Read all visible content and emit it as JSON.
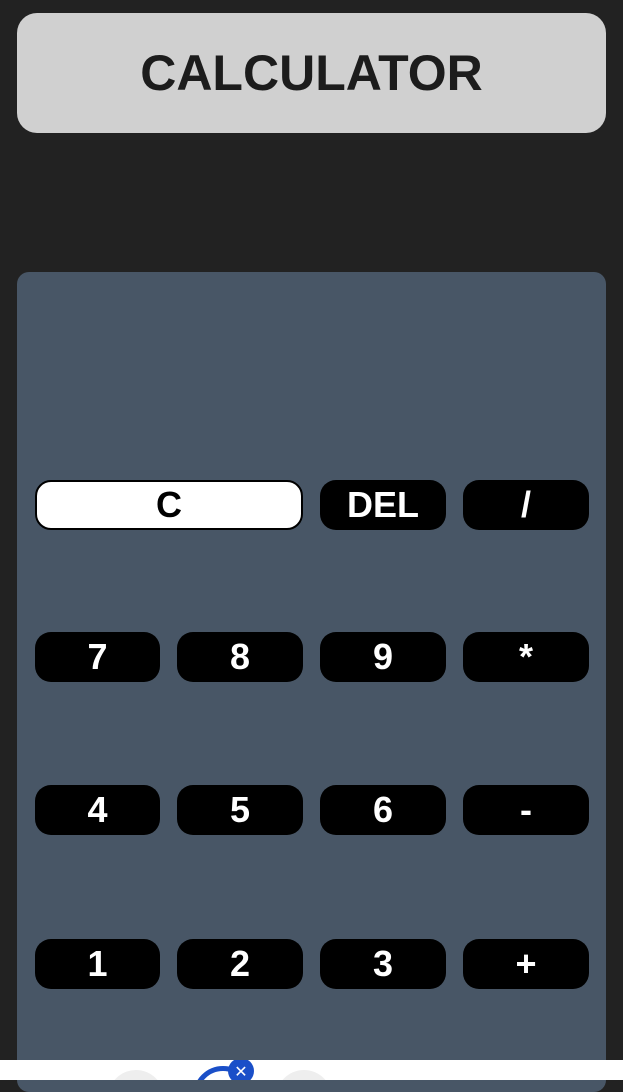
{
  "header": {
    "title": "CALCULATOR"
  },
  "keypad": {
    "row1": {
      "clear": "C",
      "delete": "DEL",
      "divide": "/"
    },
    "row2": {
      "k7": "7",
      "k8": "8",
      "k9": "9",
      "multiply": "*"
    },
    "row3": {
      "k4": "4",
      "k5": "5",
      "k6": "6",
      "subtract": "-"
    },
    "row4": {
      "k1": "1",
      "k2": "2",
      "k3": "3",
      "add": "+"
    }
  },
  "bottom_dock": {
    "badge_icon": "close-icon"
  },
  "colors": {
    "background": "#222222",
    "title_bar": "#d0d0d0",
    "keypad_panel": "#485666",
    "key": "#000000",
    "key_text": "#ffffff",
    "clear_key": "#ffffff",
    "dock_accent": "#1a4fc8"
  }
}
